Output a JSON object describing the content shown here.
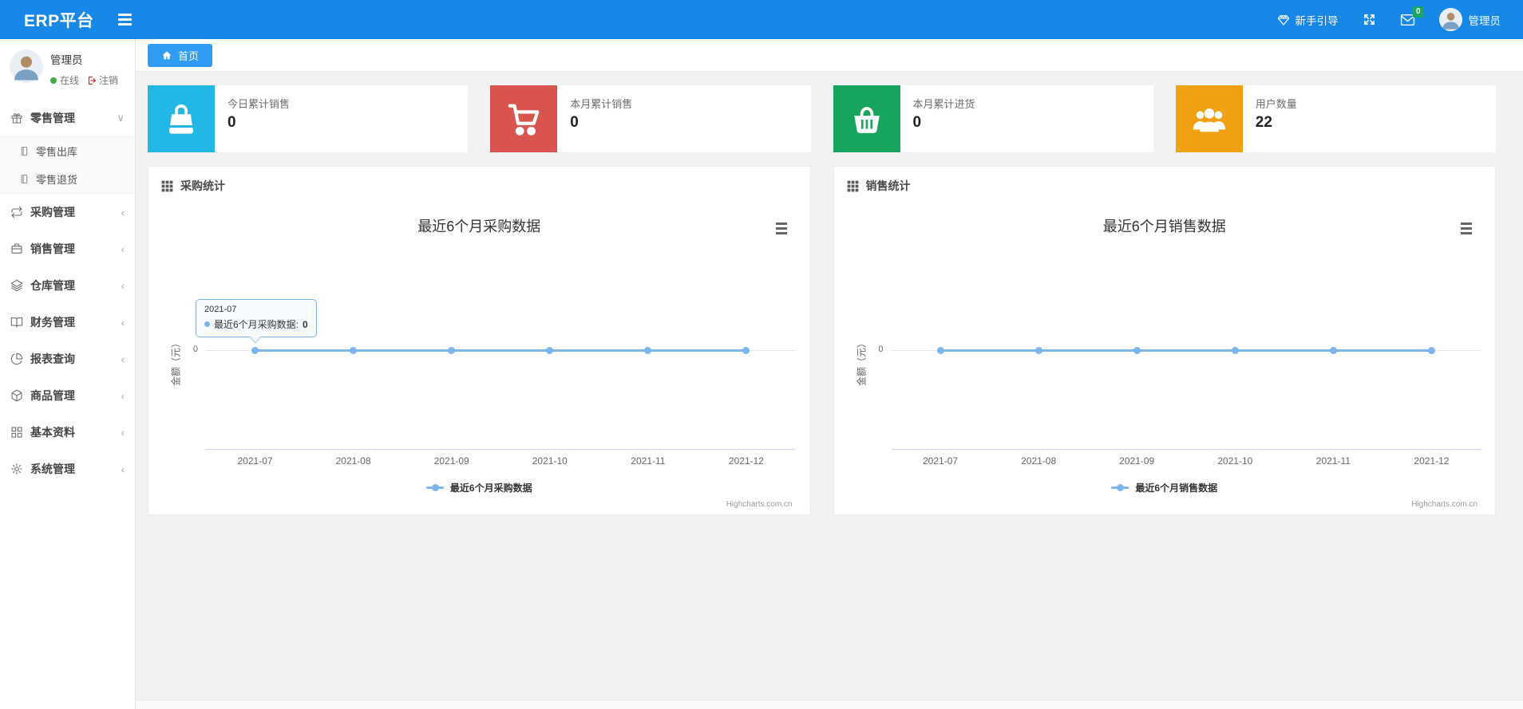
{
  "navbar": {
    "brand": "ERP平台",
    "guide_label": "新手引导",
    "message_badge": "0",
    "user_name": "管理员"
  },
  "sidebar": {
    "user": {
      "name": "管理员",
      "status": "在线",
      "logout_label": "注销"
    },
    "menu": [
      {
        "label": "零售管理",
        "icon": "gift-icon",
        "state": "expanded",
        "children": [
          {
            "label": "零售出库",
            "icon": "book-icon"
          },
          {
            "label": "零售退货",
            "icon": "book-icon"
          }
        ]
      },
      {
        "label": "采购管理",
        "icon": "repeat-icon",
        "state": "collapsed"
      },
      {
        "label": "销售管理",
        "icon": "briefcase-icon",
        "state": "collapsed"
      },
      {
        "label": "仓库管理",
        "icon": "layers-icon",
        "state": "collapsed"
      },
      {
        "label": "财务管理",
        "icon": "open-book-icon",
        "state": "collapsed"
      },
      {
        "label": "报表查询",
        "icon": "pie-chart-icon",
        "state": "collapsed"
      },
      {
        "label": "商品管理",
        "icon": "box-icon",
        "state": "collapsed"
      },
      {
        "label": "基本资料",
        "icon": "grid-icon",
        "state": "collapsed"
      },
      {
        "label": "系统管理",
        "icon": "gear-icon",
        "state": "collapsed"
      }
    ],
    "chevron_expanded": "∨",
    "chevron_collapsed": "‹"
  },
  "breadcrumb": {
    "home_tab": "首页"
  },
  "stat_cards": [
    {
      "label": "今日累计销售",
      "value": "0",
      "icon": "shopping-bag-icon",
      "color": "#23b7e5"
    },
    {
      "label": "本月累计销售",
      "value": "0",
      "icon": "shopping-cart-icon",
      "color": "#d9534f"
    },
    {
      "label": "本月累计进货",
      "value": "0",
      "icon": "shopping-basket-icon",
      "color": "#16a45f"
    },
    {
      "label": "用户数量",
      "value": "22",
      "icon": "users-icon",
      "color": "#f2a013"
    }
  ],
  "panels": [
    {
      "header": "采购统计"
    },
    {
      "header": "销售统计"
    }
  ],
  "chart_data": [
    {
      "type": "line",
      "title": "最近6个月采购数据",
      "categories": [
        "2021-07",
        "2021-08",
        "2021-09",
        "2021-10",
        "2021-11",
        "2021-12"
      ],
      "series": [
        {
          "name": "最近6个月采购数据",
          "values": [
            0,
            0,
            0,
            0,
            0,
            0
          ],
          "color": "#7cb5ec"
        }
      ],
      "xlabel": "",
      "ylabel": "金额（元）",
      "yticks": [
        "0"
      ],
      "grid": true,
      "legend_position": "bottom",
      "credit": "Highcharts.com.cn",
      "tooltip": {
        "visible": true,
        "category": "2021-07",
        "series_label": "最近6个月采购数据:",
        "value": "0"
      }
    },
    {
      "type": "line",
      "title": "最近6个月销售数据",
      "categories": [
        "2021-07",
        "2021-08",
        "2021-09",
        "2021-10",
        "2021-11",
        "2021-12"
      ],
      "series": [
        {
          "name": "最近6个月销售数据",
          "values": [
            0,
            0,
            0,
            0,
            0,
            0
          ],
          "color": "#7cb5ec"
        }
      ],
      "xlabel": "",
      "ylabel": "金额（元）",
      "yticks": [
        "0"
      ],
      "grid": true,
      "legend_position": "bottom",
      "credit": "Highcharts.com.cn",
      "tooltip": {
        "visible": false
      }
    }
  ]
}
